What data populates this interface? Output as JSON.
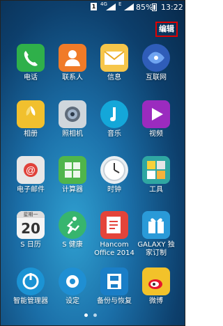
{
  "status": {
    "sim": "1",
    "network": "4G",
    "network2": "E",
    "battery": "85%",
    "time": "13:22"
  },
  "edit_label": "编辑",
  "apps": [
    {
      "label": "电话",
      "icon": "phone-icon",
      "color": "#2fb04a"
    },
    {
      "label": "联系人",
      "icon": "contacts-icon",
      "color": "#f07b28"
    },
    {
      "label": "信息",
      "icon": "messages-icon",
      "color": "#f6c64a"
    },
    {
      "label": "互联网",
      "icon": "internet-icon",
      "color": "#2f5db9"
    },
    {
      "label": "相册",
      "icon": "gallery-icon",
      "color": "#f1c02e"
    },
    {
      "label": "照相机",
      "icon": "camera-icon",
      "color": "#cfd6dc"
    },
    {
      "label": "音乐",
      "icon": "music-icon",
      "color": "#14a7d9"
    },
    {
      "label": "视频",
      "icon": "video-icon",
      "color": "#9b2bbf"
    },
    {
      "label": "电子邮件",
      "icon": "email-icon",
      "color": "#e7e7e7"
    },
    {
      "label": "计算器",
      "icon": "calculator-icon",
      "color": "#4fb54b"
    },
    {
      "label": "时钟",
      "icon": "clock-icon",
      "color": "#e9eef2"
    },
    {
      "label": "工具",
      "icon": "tools-icon",
      "color": "#2fa7a2"
    },
    {
      "label": "S 日历",
      "icon": "calendar-icon",
      "color": "#f5f5f5",
      "calendar_day": "20",
      "calendar_weekday": "星期一"
    },
    {
      "label": "S 健康",
      "icon": "health-icon",
      "color": "#37b56e"
    },
    {
      "label": "Hancom Office 2014",
      "icon": "hancom-office-icon",
      "color": "#e4443a"
    },
    {
      "label": "GALAXY 独家订制",
      "icon": "galaxy-gift-icon",
      "color": "#2a9ad8"
    },
    {
      "label": "智能管理器",
      "icon": "smart-manager-icon",
      "color": "#1b93d4"
    },
    {
      "label": "设定",
      "icon": "settings-icon",
      "color": "#1f8fd3"
    },
    {
      "label": "备份与恢复",
      "icon": "backup-restore-icon",
      "color": "#1a7ec7"
    },
    {
      "label": "微博",
      "icon": "weibo-icon",
      "color": "#f2c22a"
    }
  ],
  "page_indicator": {
    "pages": 2,
    "current": 1
  }
}
